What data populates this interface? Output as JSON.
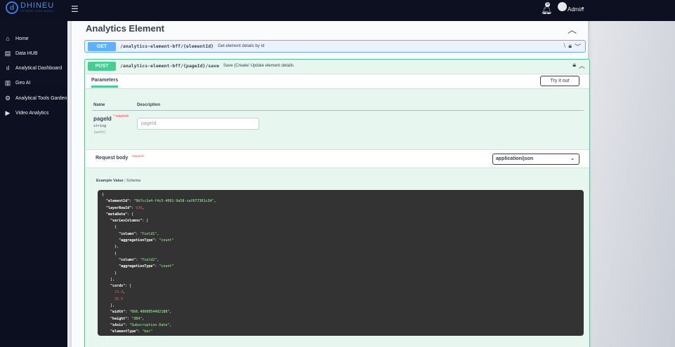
{
  "app": {
    "logo_name": "DHINEU",
    "logo_tagline": "OPTIMIZE YOUR WORLD",
    "user_name": "Admin",
    "notification_count": "5"
  },
  "sidebar": {
    "items": [
      {
        "label": "Home",
        "icon": "home-icon"
      },
      {
        "label": "Data HUB",
        "icon": "database-icon"
      },
      {
        "label": "Analytical Dashboard",
        "icon": "bar-chart-icon"
      },
      {
        "label": "Geo AI",
        "icon": "map-icon"
      },
      {
        "label": "Analytical Tools Garden",
        "icon": "gear-icon"
      },
      {
        "label": "Video Analytics",
        "icon": "video-icon"
      }
    ]
  },
  "main": {
    "title": "Analytics Element",
    "operations": [
      {
        "method": "GET",
        "path": "/analytics-element-bff/{elementId}",
        "summary": "Get element details by Id"
      },
      {
        "method": "POST",
        "path": "/analytics-element-bff/{pageId}/save",
        "summary": "Save (Create/ Update element details"
      }
    ],
    "parameters": {
      "tab_label": "Parameters",
      "try_label": "Try it out",
      "col_name": "Name",
      "col_description": "Description",
      "param": {
        "name": "pageId",
        "required_mark": "* required",
        "type": "string",
        "location": "(path)",
        "placeholder": "pageId"
      }
    },
    "request_body": {
      "title": "Request body",
      "required": "required",
      "content_type": "application/json",
      "example_label": "Example Value",
      "schema_label": "Schema",
      "example": {
        "elementId": "9b7cc1e4-f4c5-4091-9a58-caf677361c34",
        "layerRowId": "630",
        "field1": "field1",
        "field2": "field2",
        "agg": "count",
        "cord1": "23.4",
        "cord2": "35.5",
        "width": "666.4000854492188",
        "height": "384",
        "xAxis": "Subscription Date",
        "elementType": "bar"
      }
    }
  },
  "colors": {
    "get": "#61affe",
    "post": "#49cc90",
    "sidebar": "#0d1122"
  }
}
